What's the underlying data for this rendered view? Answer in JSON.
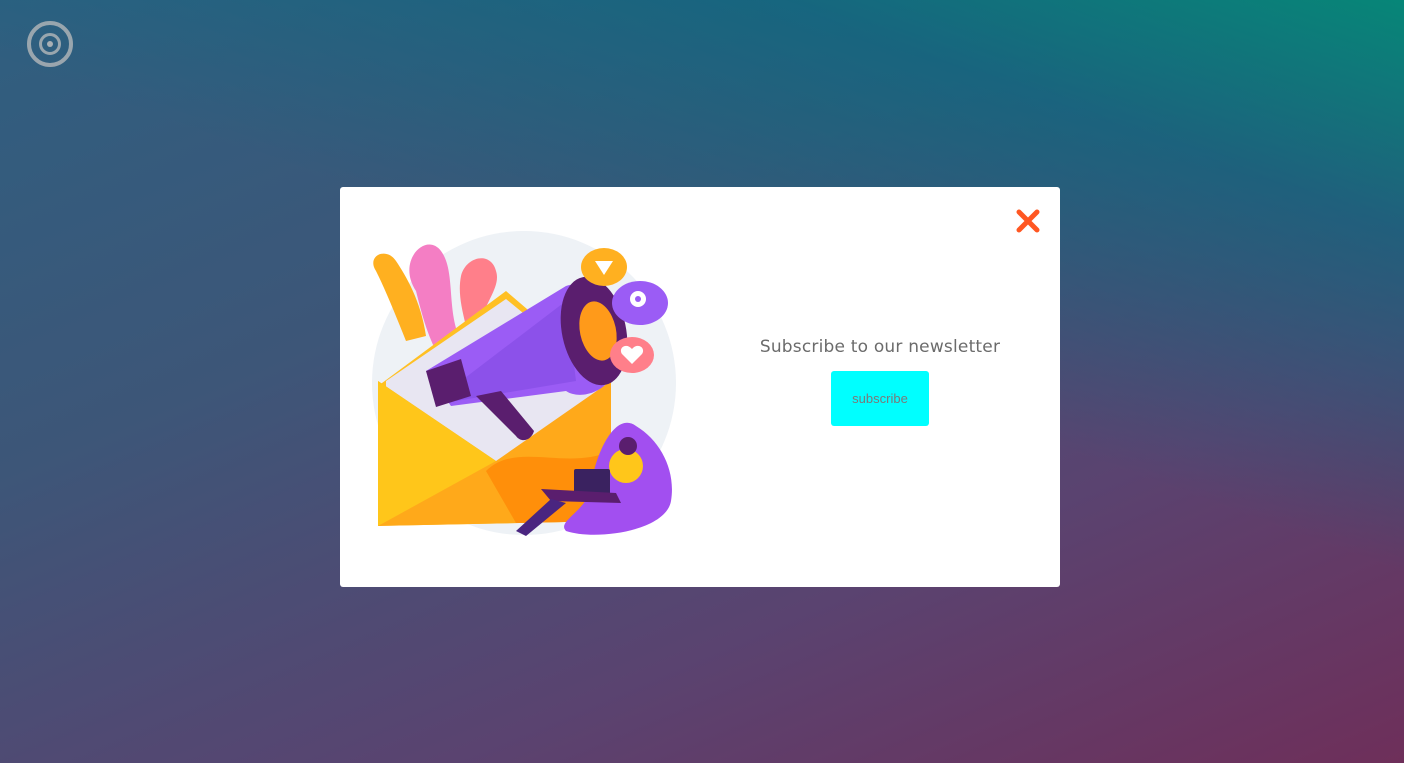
{
  "page": {
    "colors": {
      "modal_bg": "#ffffff",
      "close_icon": "#ff5722",
      "button_bg": "#00ffff",
      "title_text": "#6b6b6b"
    }
  },
  "logo": {
    "icon": "target-icon"
  },
  "modal": {
    "close_icon": "close-icon",
    "illustration": "megaphone-envelope-illustration",
    "title": "Subscribe to our newsletter",
    "subscribe_label": "subscribe"
  }
}
